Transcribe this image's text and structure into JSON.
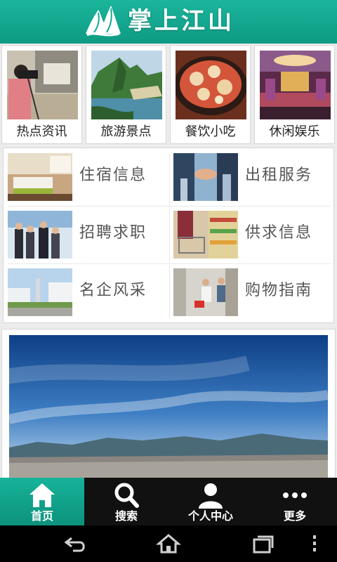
{
  "header": {
    "title": "掌上江山",
    "logo_icon": "mountain-logo-icon",
    "background": "#12a88f"
  },
  "categories": [
    {
      "label": "热点资讯",
      "image": "news-reporter-photo"
    },
    {
      "label": "旅游景点",
      "image": "scenic-river-photo"
    },
    {
      "label": "餐饮小吃",
      "image": "food-dish-photo"
    },
    {
      "label": "休闲娱乐",
      "image": "ktv-lounge-photo"
    }
  ],
  "services": [
    {
      "label": "住宿信息",
      "image": "hotel-room-photo"
    },
    {
      "label": "出租服务",
      "image": "handshake-photo"
    },
    {
      "label": "招聘求职",
      "image": "business-team-photo"
    },
    {
      "label": "供求信息",
      "image": "supermarket-cart-photo"
    },
    {
      "label": "名企风采",
      "image": "company-campus-photo"
    },
    {
      "label": "购物指南",
      "image": "shopping-women-photo"
    }
  ],
  "banner": {
    "image": "city-panorama-photo"
  },
  "bottom_nav": [
    {
      "label": "首页",
      "icon": "home-icon",
      "active": true
    },
    {
      "label": "搜索",
      "icon": "search-icon",
      "active": false
    },
    {
      "label": "个人中心",
      "icon": "user-icon",
      "active": false
    },
    {
      "label": "更多",
      "icon": "more-dots-icon",
      "active": false
    }
  ],
  "system_bar": [
    {
      "icon": "back-icon"
    },
    {
      "icon": "home-outline-icon"
    },
    {
      "icon": "recent-apps-icon"
    },
    {
      "icon": "overflow-menu-icon"
    }
  ],
  "colors": {
    "accent": "#12a88f",
    "nav_background": "#111111"
  }
}
